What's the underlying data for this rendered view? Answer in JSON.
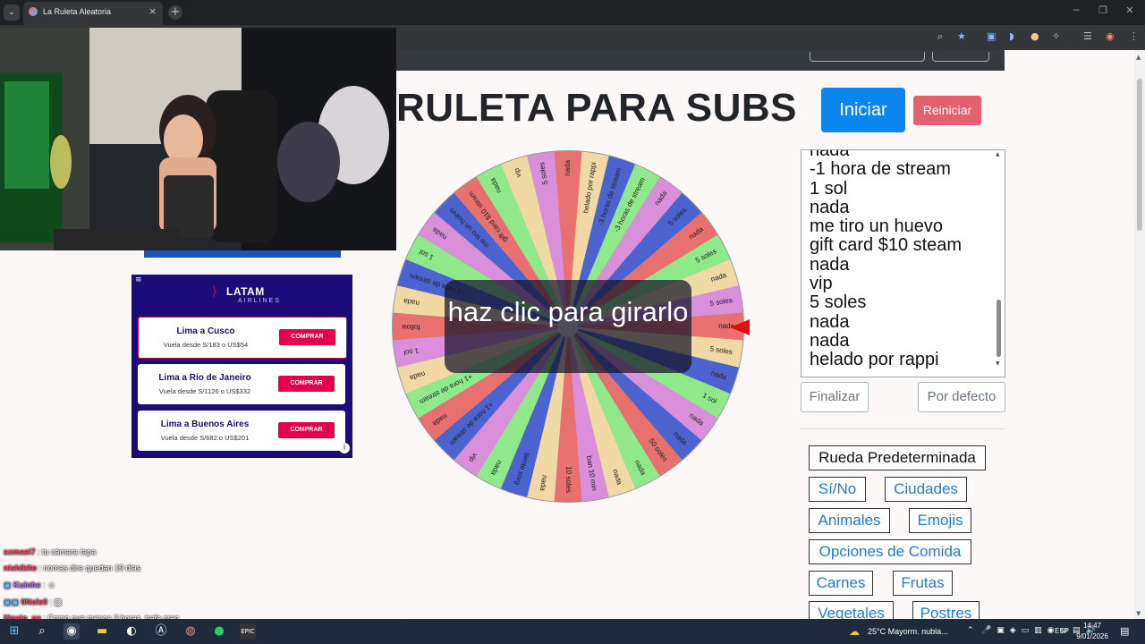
{
  "browser": {
    "tab_title": "La Ruleta Aleatoria",
    "tab_close": "×",
    "new_tab": "+"
  },
  "page": {
    "title": "RULETA PARA SUBS",
    "start_button": "Iniciar",
    "reset_button": "Reiniciar",
    "spin_prompt": "haz clic para girarlo",
    "options": [
      "nada",
      "-1 hora de stream",
      "1 sol",
      "nada",
      "me tiro un huevo",
      "gift card $10 steam",
      "nada",
      "vip",
      "5 soles",
      "nada",
      "nada",
      "helado por rappi"
    ],
    "finish_button": "Finalizar",
    "default_button": "Por defecto",
    "presets": [
      "Rueda Predeterminada",
      "Sí/No",
      "Ciudades",
      "Animales",
      "Emojis",
      "Opciones de Comida",
      "Carnes",
      "Frutas",
      "Vegetales",
      "Postres"
    ]
  },
  "wheel": {
    "segments": [
      "nada",
      "helado por rappi",
      "-3 horas de stream",
      "-3 horas de stream",
      "nada",
      "5 soles",
      "nada",
      "5 soles",
      "nada",
      "5 soles",
      "nada",
      "5 soles",
      "nada",
      "1 sol",
      "nada",
      "nada",
      "50 soles",
      "nada",
      "nada",
      "ban 10 min",
      "10 soles",
      "nada",
      "tiente sorg",
      "nada",
      "vip",
      "+1 hora de stream",
      "nada",
      "+1 hora de stream",
      "nada",
      "1 sol",
      "follow",
      "nada",
      "+1 hora de stream",
      "1 sol",
      "nada",
      "me tiro un huevo",
      "gift card $10 steam",
      "nada",
      "vip",
      "5 soles"
    ],
    "colors": [
      "#e8706e",
      "#f1d9a6",
      "#4a63cf",
      "#8fe98a",
      "#d98fd9",
      "#4a63cf",
      "#e8706e",
      "#8fe98a",
      "#f1d9a6",
      "#d98fd9"
    ]
  },
  "ad": {
    "brand": "LATAM",
    "brand_sub": "AIRLINES",
    "menu": "≡",
    "cards": [
      {
        "dest": "Lima a Cusco",
        "price": "Vuela desde S/183 o US$54",
        "cta": "COMPRAR"
      },
      {
        "dest": "Lima a Río de Janeiro",
        "price": "Vuela desde S/1126 o US$332",
        "cta": "COMPRAR"
      },
      {
        "dest": "Lima a Buenos Aires",
        "price": "Vuela desde S/682 o US$201",
        "cta": "COMPRAR"
      }
    ]
  },
  "chat": [
    {
      "user": "sxmael7",
      "color": "#ff4d6d",
      "text": ": tu cámara tapa"
    },
    {
      "user": "nishikito",
      "color": "#ff4d6d",
      "text": ": nomas dire quedan 19 dias"
    },
    {
      "user": "Kuinhe",
      "color": "#b46dff",
      "text": ":"
    },
    {
      "user": "0Nole0",
      "color": "#ff4d6d",
      "text": ":"
    },
    {
      "user": "lilgato_pe",
      "color": "#ff4d6d",
      "text": ": Como que menos 3 horas, trafa creo"
    }
  ],
  "taskbar": {
    "weather": "25°C  Mayorm. nubla...",
    "lang": "ESP",
    "time": "14:47",
    "date": "9/01/2026"
  }
}
